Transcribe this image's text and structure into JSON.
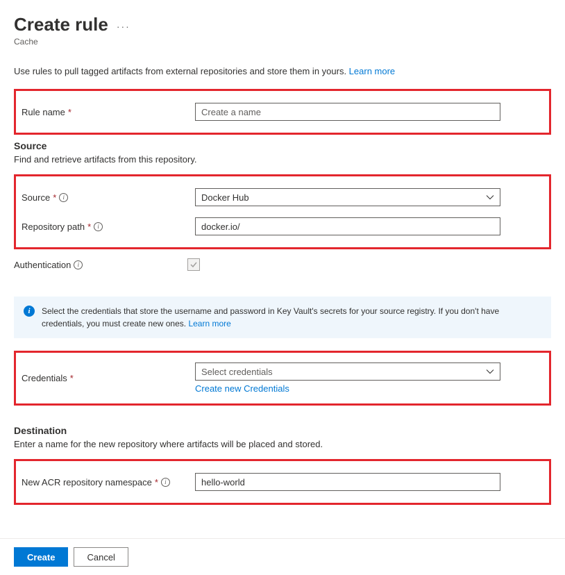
{
  "header": {
    "title": "Create rule",
    "subtitle": "Cache"
  },
  "intro": {
    "text": "Use rules to pull tagged artifacts from external repositories and store them in yours. ",
    "learn_more": "Learn more"
  },
  "rule_name": {
    "label": "Rule name",
    "placeholder": "Create a name",
    "value": ""
  },
  "source_section": {
    "heading": "Source",
    "description": "Find and retrieve artifacts from this repository."
  },
  "source": {
    "label": "Source",
    "value": "Docker Hub"
  },
  "repo_path": {
    "label": "Repository path",
    "value": "docker.io/"
  },
  "authentication": {
    "label": "Authentication"
  },
  "info_banner": {
    "text": "Select the credentials that store the username and password in Key Vault's secrets for your source registry. If you don't have credentials, you must create new ones. ",
    "learn_more": "Learn more"
  },
  "credentials": {
    "label": "Credentials",
    "placeholder": "Select credentials",
    "create_link": "Create new Credentials"
  },
  "destination_section": {
    "heading": "Destination",
    "description": "Enter a name for the new repository where artifacts will be placed and stored."
  },
  "namespace": {
    "label": "New ACR repository namespace",
    "value": "hello-world"
  },
  "footer": {
    "create": "Create",
    "cancel": "Cancel"
  }
}
